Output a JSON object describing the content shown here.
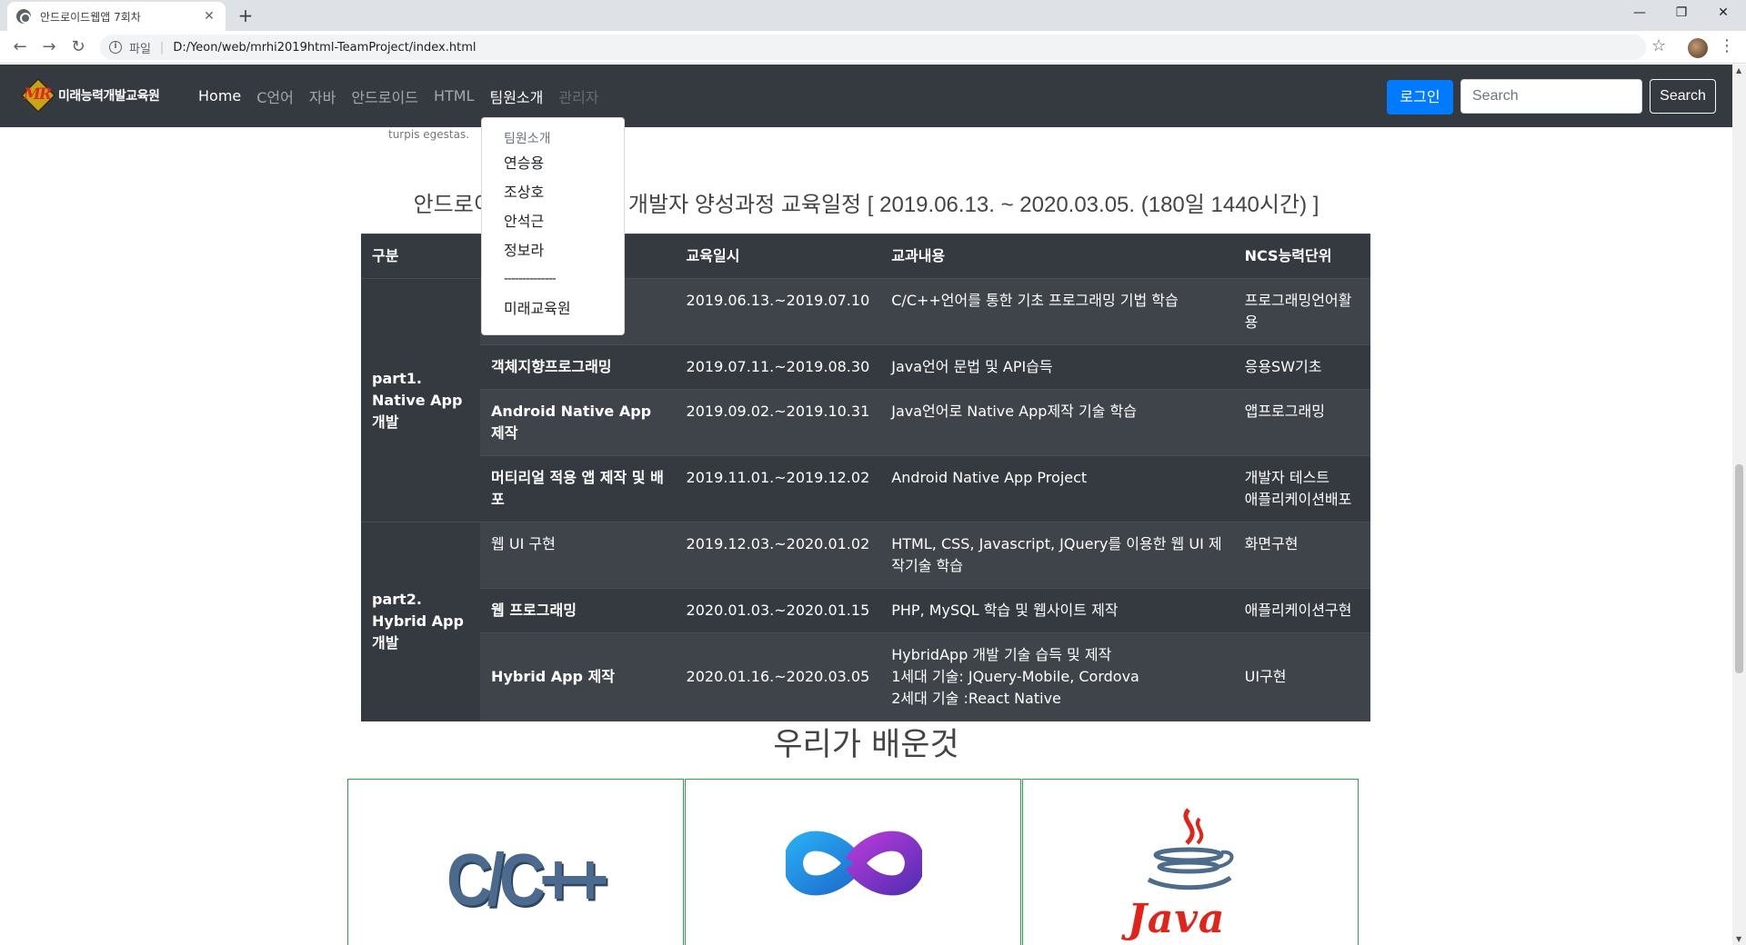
{
  "browser": {
    "tab_title": "안드로이드웹앱 7회차",
    "new_tab": "+",
    "tab_close": "✕",
    "url_scheme": "파일",
    "url_sep": "|",
    "url": "D:/Yeon/web/mrhi2019html-TeamProject/index.html",
    "back": "←",
    "forward": "→",
    "reload": "↻",
    "star": "☆",
    "menu": "⋮",
    "minimize": "—",
    "restore": "❐",
    "close": "✕"
  },
  "navbar": {
    "brand_text": "미래능력개발교육원",
    "brand_mark": "MR",
    "links": [
      {
        "label": "Home",
        "state": "active"
      },
      {
        "label": "C언어",
        "state": "normal"
      },
      {
        "label": "자바",
        "state": "normal"
      },
      {
        "label": "안드로이드",
        "state": "normal"
      },
      {
        "label": "HTML",
        "state": "normal"
      },
      {
        "label": "팀원소개",
        "state": "active"
      },
      {
        "label": "관리자",
        "state": "disabled"
      }
    ],
    "login_label": "로그인",
    "search_placeholder": "Search",
    "search_button": "Search"
  },
  "dropdown": {
    "header": "팀원소개",
    "items": [
      "연승용",
      "조상호",
      "안석근",
      "정보라"
    ],
    "divider": "--------------",
    "footer_item": "미래교육원"
  },
  "content": {
    "lorem_tail": "turpis egestas.",
    "schedule_title_a": "안드로이",
    "schedule_title_b": "개발자 양성과정 교육일정 [ 2019.06.13. ~ 2020.03.05. (180일 1440시간) ]",
    "table_headers": [
      "구분",
      "",
      "교육일시",
      "교과내용",
      "NCS능력단위"
    ],
    "part1_label": "part1.\nNative App개발",
    "part2_label": "part2.\nHybrid App개발",
    "rows": [
      {
        "subject": "",
        "date": "2019.06.13.~2019.07.10",
        "content": "C/C++언어를 통한 기초 프로그래밍 기법 학습",
        "ncs": "프로그래밍언어활용"
      },
      {
        "subject": "객체지향프로그래밍",
        "date": "2019.07.11.~2019.08.30",
        "content": "Java언어 문법 및 API습득",
        "ncs": "응용SW기초"
      },
      {
        "subject": "Android Native App 제작",
        "date": "2019.09.02.~2019.10.31",
        "content": "Java언어로 Native App제작 기술 학습",
        "ncs": "앱프로그래밍"
      },
      {
        "subject": "머티리얼 적용 앱 제작 및 배포",
        "date": "2019.11.01.~2019.12.02",
        "content": "Android Native App Project",
        "ncs": "개발자 테스트\n애플리케이션배포"
      },
      {
        "subject": "웹 UI 구현",
        "date": "2019.12.03.~2020.01.02",
        "content": "HTML, CSS, Javascript, JQuery를 이용한 웹 UI 제작기술 학습",
        "ncs": "화면구현"
      },
      {
        "subject": "웹 프로그래밍",
        "date": "2020.01.03.~2020.01.15",
        "content": "PHP, MySQL 학습 및 웹사이트 제작",
        "ncs": "애플리케이션구현"
      },
      {
        "subject": "Hybrid App 제작",
        "date": "2020.01.16.~2020.03.05",
        "content": "HybridApp 개발 기술 습득 및 제작\n1세대   기술: JQuery-Mobile, Cordova\n2세대 기술 :React Native",
        "ncs": "UI구현"
      }
    ],
    "learned_title": "우리가 배운것",
    "logo_cpp": "C/C++",
    "logo_java": "Java"
  },
  "colors": {
    "navbar_bg": "#343a40",
    "primary": "#007bff",
    "card_border": "#28a745",
    "java_red": "#e2231a"
  },
  "icons": [
    "globe-favicon-icon",
    "info-icon",
    "star-icon",
    "kebab-menu-icon",
    "visual-studio-logo-icon",
    "java-cup-logo-icon"
  ]
}
